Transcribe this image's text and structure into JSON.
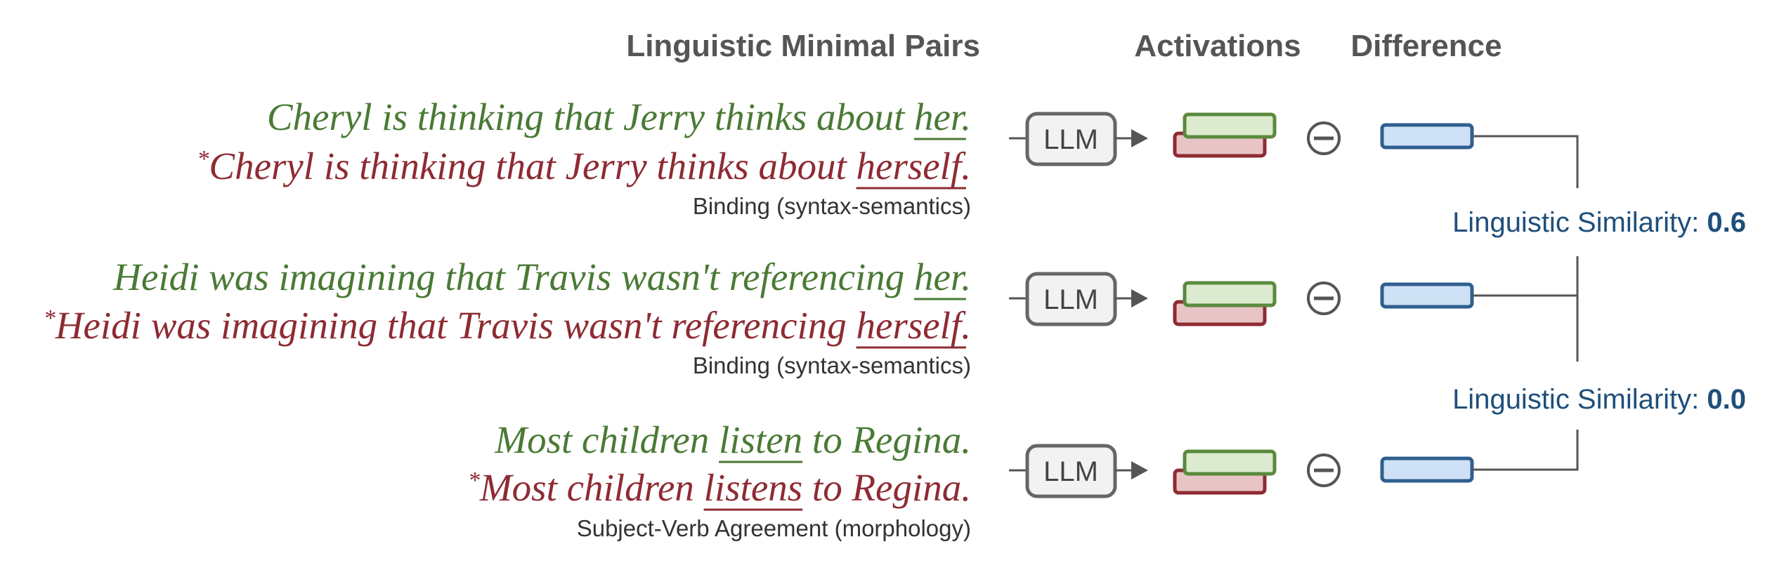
{
  "headers": {
    "pairs": "Linguistic Minimal Pairs",
    "activations": "Activations",
    "difference": "Difference"
  },
  "rows": [
    {
      "good": {
        "pre": "Cheryl is thinking that Jerry thinks about ",
        "key": "her",
        "post": "."
      },
      "bad": {
        "star": "*",
        "pre": "Cheryl is thinking that Jerry thinks about ",
        "key": "herself",
        "post": "."
      },
      "category": "Binding (syntax-semantics)",
      "model": "LLM",
      "minus": "⊖"
    },
    {
      "good": {
        "pre": "Heidi was imagining that Travis wasn't referencing ",
        "key": "her",
        "post": "."
      },
      "bad": {
        "star": "*",
        "pre": "Heidi was imagining that Travis wasn't referencing ",
        "key": "herself",
        "post": "."
      },
      "category": "Binding (syntax-semantics)",
      "model": "LLM",
      "minus": "⊖"
    },
    {
      "good": {
        "pre": "Most children ",
        "key": "listen",
        "post": " to Regina."
      },
      "bad": {
        "star": "*",
        "pre": "Most children ",
        "key": "listens",
        "post": " to Regina."
      },
      "category": "Subject-Verb Agreement (morphology)",
      "model": "LLM",
      "minus": "⊖"
    }
  ],
  "similarities": [
    {
      "label": "Linguistic Similarity: ",
      "value": "0.6"
    },
    {
      "label": "Linguistic Similarity: ",
      "value": "0.0"
    }
  ],
  "colors": {
    "good": "#4a7a35",
    "bad": "#8e2b33",
    "difference_fill": "#cfe2f5",
    "difference_stroke": "#2f5f8f",
    "similarity_text": "#1f4f7a"
  }
}
